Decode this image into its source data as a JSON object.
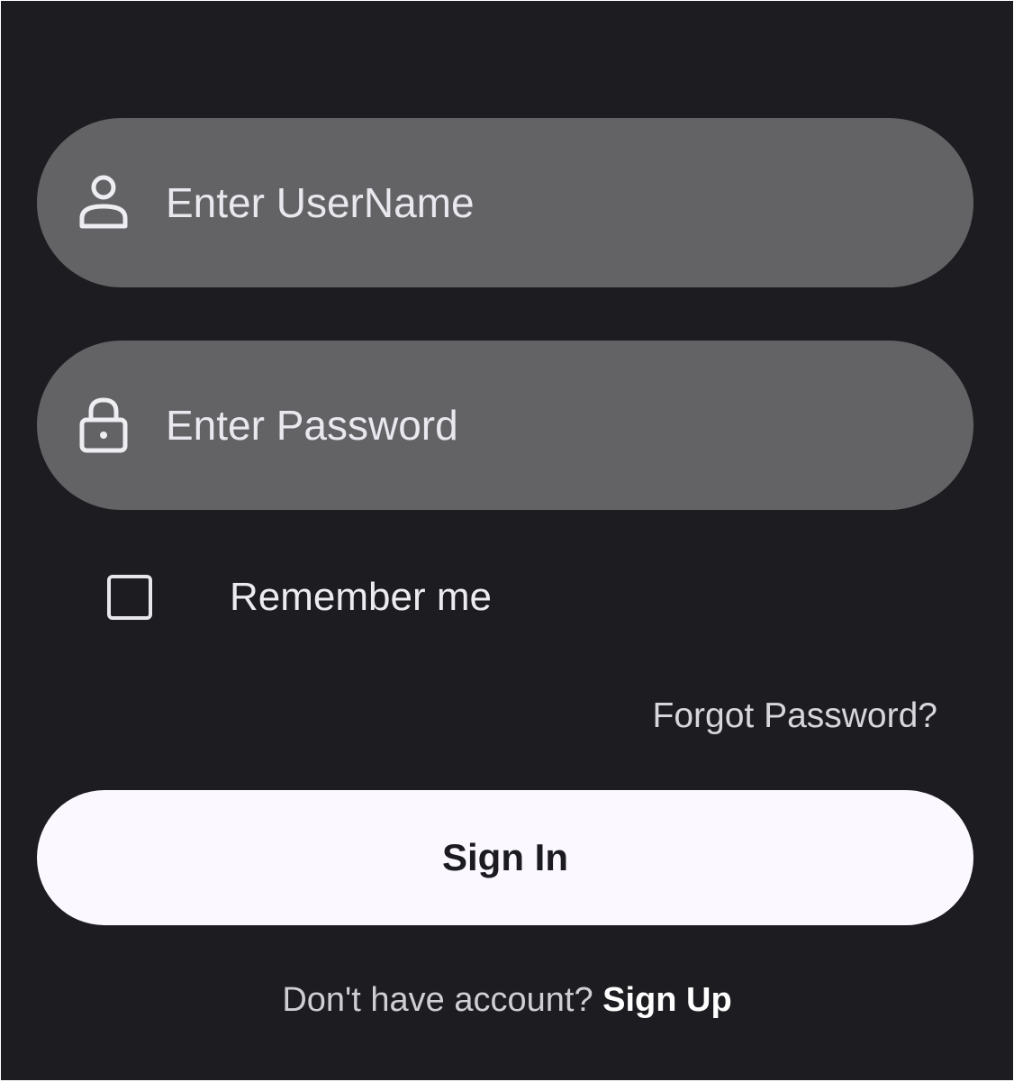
{
  "form": {
    "username": {
      "placeholder": "Enter UserName",
      "value": "",
      "icon": "person-icon"
    },
    "password": {
      "placeholder": "Enter Password",
      "value": "",
      "icon": "lock-icon"
    },
    "remember": {
      "label": "Remember me",
      "checked": false
    },
    "forgot_label": "Forgot Password?",
    "signin_label": "Sign In",
    "footer": {
      "prompt": "Don't have account? ",
      "signup_label": "Sign Up"
    }
  },
  "colors": {
    "background": "#1d1c21",
    "field": "#636365",
    "button": "#fbf8ff",
    "button_text": "#1b1b20"
  }
}
